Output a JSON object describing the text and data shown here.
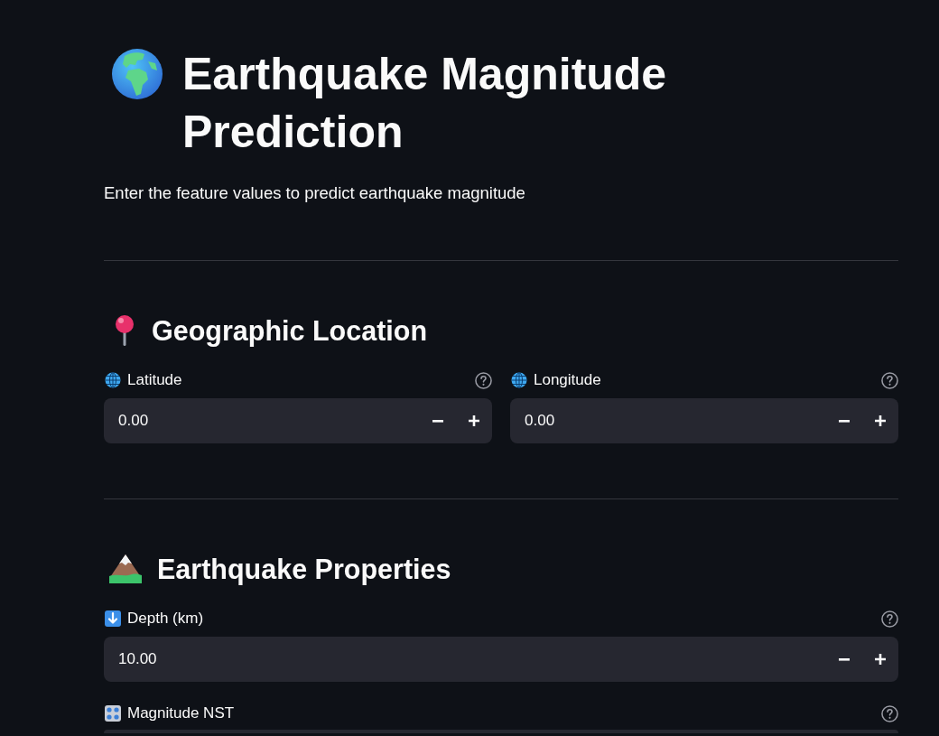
{
  "title": "Earthquake Magnitude Prediction",
  "subtitle": "Enter the feature values to predict earthquake magnitude",
  "sections": [
    {
      "heading": "Geographic Location",
      "fields": [
        {
          "label": "Latitude",
          "value": "0.00"
        },
        {
          "label": "Longitude",
          "value": "0.00"
        }
      ]
    },
    {
      "heading": "Earthquake Properties",
      "fields": [
        {
          "label": "Depth (km)",
          "value": "10.00"
        },
        {
          "label": "Magnitude NST"
        }
      ]
    }
  ]
}
